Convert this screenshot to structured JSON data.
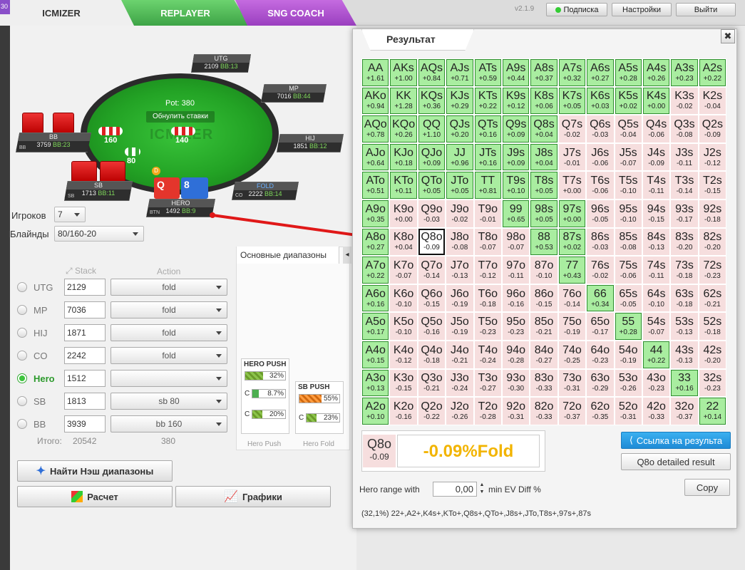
{
  "tabs": {
    "icmizer": "ICMIZER",
    "replayer": "REPLAYER",
    "sng": "SNG COACH"
  },
  "header": {
    "version": "v2.1.9",
    "subscribe": "Подписка",
    "settings": "Настройки",
    "logout": "Выйти"
  },
  "edge_label": "30",
  "table": {
    "pot": "Pot: 380",
    "reset": "Обнулить ставки",
    "logo": "ICMIZER",
    "bets": {
      "bb": "160",
      "sb": "80",
      "hero": "140"
    },
    "dealer": "D",
    "hero_cards": [
      "Q",
      "8"
    ],
    "seats": {
      "utg": {
        "name": "UTG",
        "stack": "2109",
        "bb": "BB:13"
      },
      "mp": {
        "name": "MP",
        "stack": "7016",
        "bb": "BB:44"
      },
      "hij": {
        "name": "HIJ",
        "stack": "1851",
        "bb": "BB:12"
      },
      "co": {
        "name": "FOLD",
        "stack": "2222",
        "bb": "BB:14",
        "pos": "CO"
      },
      "hero": {
        "name": "HERO",
        "stack": "1492",
        "bb": "BB:9",
        "pos": "BTN"
      },
      "sb": {
        "name": "SB",
        "stack": "1713",
        "bb": "BB:11",
        "pos": "SB"
      },
      "bb": {
        "name": "BB",
        "stack": "3759",
        "bb": "BB:23",
        "pos": "BB"
      }
    }
  },
  "settings": {
    "players_label": "Игроков",
    "players": "7",
    "blinds_label": "Блайнды",
    "blinds": "80/160-20"
  },
  "positions": {
    "stack_header": "Stack",
    "action_header": "Action",
    "rows": [
      {
        "name": "UTG",
        "stack": "2129",
        "action": "fold",
        "selected": false
      },
      {
        "name": "MP",
        "stack": "7036",
        "action": "fold",
        "selected": false
      },
      {
        "name": "HIJ",
        "stack": "1871",
        "action": "fold",
        "selected": false
      },
      {
        "name": "CO",
        "stack": "2242",
        "action": "fold",
        "selected": false
      },
      {
        "name": "Hero",
        "stack": "1512",
        "action": "",
        "selected": true
      },
      {
        "name": "SB",
        "stack": "1813",
        "action": "sb 80",
        "selected": false
      },
      {
        "name": "BB",
        "stack": "3939",
        "action": "bb 160",
        "selected": false
      }
    ],
    "total_label": "Итого:",
    "total": "20542",
    "total_action": "380"
  },
  "ranges": {
    "tab": "Основные диапазоны",
    "hero_push": {
      "title": "HERO PUSH",
      "main": "32%",
      "c1": "8.7%",
      "c2": "20%",
      "footer": "Hero Push"
    },
    "sb_push": {
      "title": "SB PUSH",
      "main": "55%",
      "c1": "23%",
      "footer": "Hero Fold"
    },
    "c_label": "C"
  },
  "buttons": {
    "nash": "Найти Нэш диапазоны",
    "calc": "Расчет",
    "charts": "Графики"
  },
  "result": {
    "title": "Результат",
    "close": "✖",
    "selected_hand": "Q8o",
    "selected_ev": "-0.09",
    "selected_text": "-0.09%Fold",
    "link_btn": "Ссылка на результа",
    "detail_btn": "Q8o detailed result",
    "hero_range_label": "Hero range with",
    "hero_range_value": "0,00",
    "min_ev_label": "min EV Diff %",
    "copy": "Copy",
    "range_text": "(32,1%) 22+,A2+,K4s+,KTo+,Q8s+,QTo+,J8s+,JTo,T8s+,97s+,87s"
  },
  "matrix": {
    "hands": [
      [
        "AA",
        "AKs",
        "AQs",
        "AJs",
        "ATs",
        "A9s",
        "A8s",
        "A7s",
        "A6s",
        "A5s",
        "A4s",
        "A3s",
        "A2s"
      ],
      [
        "AKo",
        "KK",
        "KQs",
        "KJs",
        "KTs",
        "K9s",
        "K8s",
        "K7s",
        "K6s",
        "K5s",
        "K4s",
        "K3s",
        "K2s"
      ],
      [
        "AQo",
        "KQo",
        "QQ",
        "QJs",
        "QTs",
        "Q9s",
        "Q8s",
        "Q7s",
        "Q6s",
        "Q5s",
        "Q4s",
        "Q3s",
        "Q2s"
      ],
      [
        "AJo",
        "KJo",
        "QJo",
        "JJ",
        "JTs",
        "J9s",
        "J8s",
        "J7s",
        "J6s",
        "J5s",
        "J4s",
        "J3s",
        "J2s"
      ],
      [
        "ATo",
        "KTo",
        "QTo",
        "JTo",
        "TT",
        "T9s",
        "T8s",
        "T7s",
        "T6s",
        "T5s",
        "T4s",
        "T3s",
        "T2s"
      ],
      [
        "A9o",
        "K9o",
        "Q9o",
        "J9o",
        "T9o",
        "99",
        "98s",
        "97s",
        "96s",
        "95s",
        "94s",
        "93s",
        "92s"
      ],
      [
        "A8o",
        "K8o",
        "Q8o",
        "J8o",
        "T8o",
        "98o",
        "88",
        "87s",
        "86s",
        "85s",
        "84s",
        "83s",
        "82s"
      ],
      [
        "A7o",
        "K7o",
        "Q7o",
        "J7o",
        "T7o",
        "97o",
        "87o",
        "77",
        "76s",
        "75s",
        "74s",
        "73s",
        "72s"
      ],
      [
        "A6o",
        "K6o",
        "Q6o",
        "J6o",
        "T6o",
        "96o",
        "86o",
        "76o",
        "66",
        "65s",
        "64s",
        "63s",
        "62s"
      ],
      [
        "A5o",
        "K5o",
        "Q5o",
        "J5o",
        "T5o",
        "95o",
        "85o",
        "75o",
        "65o",
        "55",
        "54s",
        "53s",
        "52s"
      ],
      [
        "A4o",
        "K4o",
        "Q4o",
        "J4o",
        "T4o",
        "94o",
        "84o",
        "74o",
        "64o",
        "54o",
        "44",
        "43s",
        "42s"
      ],
      [
        "A3o",
        "K3o",
        "Q3o",
        "J3o",
        "T3o",
        "93o",
        "83o",
        "73o",
        "63o",
        "53o",
        "43o",
        "33",
        "32s"
      ],
      [
        "A2o",
        "K2o",
        "Q2o",
        "J2o",
        "T2o",
        "92o",
        "82o",
        "72o",
        "62o",
        "52o",
        "42o",
        "32o",
        "22"
      ]
    ],
    "values": [
      [
        "+1.61",
        "+1.00",
        "+0.84",
        "+0.71",
        "+0.59",
        "+0.44",
        "+0.37",
        "+0.32",
        "+0.27",
        "+0.28",
        "+0.26",
        "+0.23",
        "+0.22"
      ],
      [
        "+0.94",
        "+1.28",
        "+0.36",
        "+0.29",
        "+0.22",
        "+0.12",
        "+0.06",
        "+0.05",
        "+0.03",
        "+0.02",
        "+0.00",
        "-0.02",
        "-0.04"
      ],
      [
        "+0.78",
        "+0.26",
        "+1.10",
        "+0.20",
        "+0.16",
        "+0.09",
        "+0.04",
        "-0.02",
        "-0.03",
        "-0.04",
        "-0.06",
        "-0.08",
        "-0.09"
      ],
      [
        "+0.64",
        "+0.18",
        "+0.09",
        "+0.96",
        "+0.16",
        "+0.09",
        "+0.04",
        "-0.01",
        "-0.06",
        "-0.07",
        "-0.09",
        "-0.11",
        "-0.12"
      ],
      [
        "+0.51",
        "+0.11",
        "+0.05",
        "+0.05",
        "+0.81",
        "+0.10",
        "+0.05",
        "+0.00",
        "-0.06",
        "-0.10",
        "-0.11",
        "-0.14",
        "-0.15"
      ],
      [
        "+0.35",
        "+0.00",
        "-0.03",
        "-0.02",
        "-0.01",
        "+0.65",
        "+0.05",
        "+0.00",
        "-0.05",
        "-0.10",
        "-0.15",
        "-0.17",
        "-0.18"
      ],
      [
        "+0.27",
        "+0.04",
        "-0.09",
        "-0.08",
        "-0.07",
        "-0.07",
        "+0.53",
        "+0.02",
        "-0.03",
        "-0.08",
        "-0.13",
        "-0.20",
        "-0.20"
      ],
      [
        "+0.22",
        "-0.07",
        "-0.14",
        "-0.13",
        "-0.12",
        "-0.11",
        "-0.10",
        "+0.43",
        "-0.02",
        "-0.06",
        "-0.11",
        "-0.18",
        "-0.23"
      ],
      [
        "+0.16",
        "-0.10",
        "-0.15",
        "-0.19",
        "-0.18",
        "-0.16",
        "-0.15",
        "-0.14",
        "+0.34",
        "-0.05",
        "-0.10",
        "-0.18",
        "-0.21"
      ],
      [
        "+0.17",
        "-0.10",
        "-0.16",
        "-0.19",
        "-0.23",
        "-0.23",
        "-0.21",
        "-0.19",
        "-0.17",
        "+0.28",
        "-0.07",
        "-0.13",
        "-0.18"
      ],
      [
        "+0.15",
        "-0.12",
        "-0.18",
        "-0.21",
        "-0.24",
        "-0.28",
        "-0.27",
        "-0.25",
        "-0.23",
        "-0.19",
        "+0.22",
        "-0.13",
        "-0.20"
      ],
      [
        "+0.13",
        "-0.15",
        "-0.21",
        "-0.24",
        "-0.27",
        "-0.30",
        "-0.33",
        "-0.31",
        "-0.29",
        "-0.26",
        "-0.23",
        "+0.16",
        "-0.23"
      ],
      [
        "+0.10",
        "-0.16",
        "-0.22",
        "-0.26",
        "-0.28",
        "-0.31",
        "-0.33",
        "-0.37",
        "-0.35",
        "-0.31",
        "-0.33",
        "-0.37",
        "+0.14"
      ]
    ],
    "in_range": [
      [
        1,
        1,
        1,
        1,
        1,
        1,
        1,
        1,
        1,
        1,
        1,
        1,
        1
      ],
      [
        1,
        1,
        1,
        1,
        1,
        1,
        1,
        1,
        1,
        1,
        1,
        0,
        0
      ],
      [
        1,
        1,
        1,
        1,
        1,
        1,
        1,
        0,
        0,
        0,
        0,
        0,
        0
      ],
      [
        1,
        1,
        1,
        1,
        1,
        1,
        1,
        0,
        0,
        0,
        0,
        0,
        0
      ],
      [
        1,
        1,
        1,
        1,
        1,
        1,
        1,
        0,
        0,
        0,
        0,
        0,
        0
      ],
      [
        1,
        0,
        0,
        0,
        0,
        1,
        1,
        1,
        0,
        0,
        0,
        0,
        0
      ],
      [
        1,
        0,
        0,
        0,
        0,
        0,
        1,
        1,
        0,
        0,
        0,
        0,
        0
      ],
      [
        1,
        0,
        0,
        0,
        0,
        0,
        0,
        1,
        0,
        0,
        0,
        0,
        0
      ],
      [
        1,
        0,
        0,
        0,
        0,
        0,
        0,
        0,
        1,
        0,
        0,
        0,
        0
      ],
      [
        1,
        0,
        0,
        0,
        0,
        0,
        0,
        0,
        0,
        1,
        0,
        0,
        0
      ],
      [
        1,
        0,
        0,
        0,
        0,
        0,
        0,
        0,
        0,
        0,
        1,
        0,
        0
      ],
      [
        1,
        0,
        0,
        0,
        0,
        0,
        0,
        0,
        0,
        0,
        0,
        1,
        0
      ],
      [
        1,
        0,
        0,
        0,
        0,
        0,
        0,
        0,
        0,
        0,
        0,
        0,
        1
      ]
    ],
    "selected": "Q8o"
  },
  "colors": {
    "positive": "#a9eda0",
    "negative": "#f6dede",
    "accent": "#2f9be0",
    "fold_text": "#f2b400"
  }
}
